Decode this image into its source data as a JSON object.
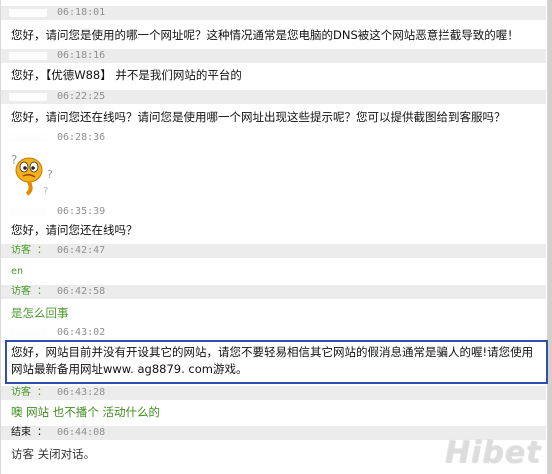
{
  "messages": [
    {
      "sender": "",
      "time": "06:18:01",
      "text": "您好，请问您是使用的哪一个网址呢？这种情况通常是您电脑的DNS被这个网站恶意拦截导致的喔！"
    },
    {
      "sender": "",
      "time": "06:18:16",
      "text": "您好，【优德W88】 并不是我们网站的平台的"
    },
    {
      "sender": "",
      "time": "06:22:25",
      "text": "您好，请问您还在线吗？请问您是使用哪一个网址出现这些提示呢？您可以提供截图给到客服吗？"
    },
    {
      "sender": "",
      "time": "06:28:36",
      "text": ""
    },
    {
      "sender": "",
      "time": "06:35:39",
      "text": "您好，请问您还在线吗？"
    },
    {
      "sender": "访客 ：",
      "time": "06:42:47",
      "text": "en"
    },
    {
      "sender": "访客 ：",
      "time": "06:42:58",
      "text": "是怎么回事"
    },
    {
      "sender": "",
      "time": "06:43:02",
      "text": "您好，网站目前并没有开设其它的网站，请您不要轻易相信其它网站的假消息通常是骗人的喔!请您使用网站最新备用网址www. ag8879. com游戏。"
    },
    {
      "sender": "访客 ：",
      "time": "06:43:28",
      "text": "噢 网站 也不播个 活动什么的"
    },
    {
      "sender": "结束 ：",
      "time": "06:44:08",
      "text": "访客 关闭对话。"
    }
  ],
  "emoticon": "confused-face-emoticon",
  "watermark": "Hibet",
  "colors": {
    "highlight_border": "#2f4fb0",
    "visitor_green": "#4a9b2a",
    "header_bg": "#ececec"
  }
}
